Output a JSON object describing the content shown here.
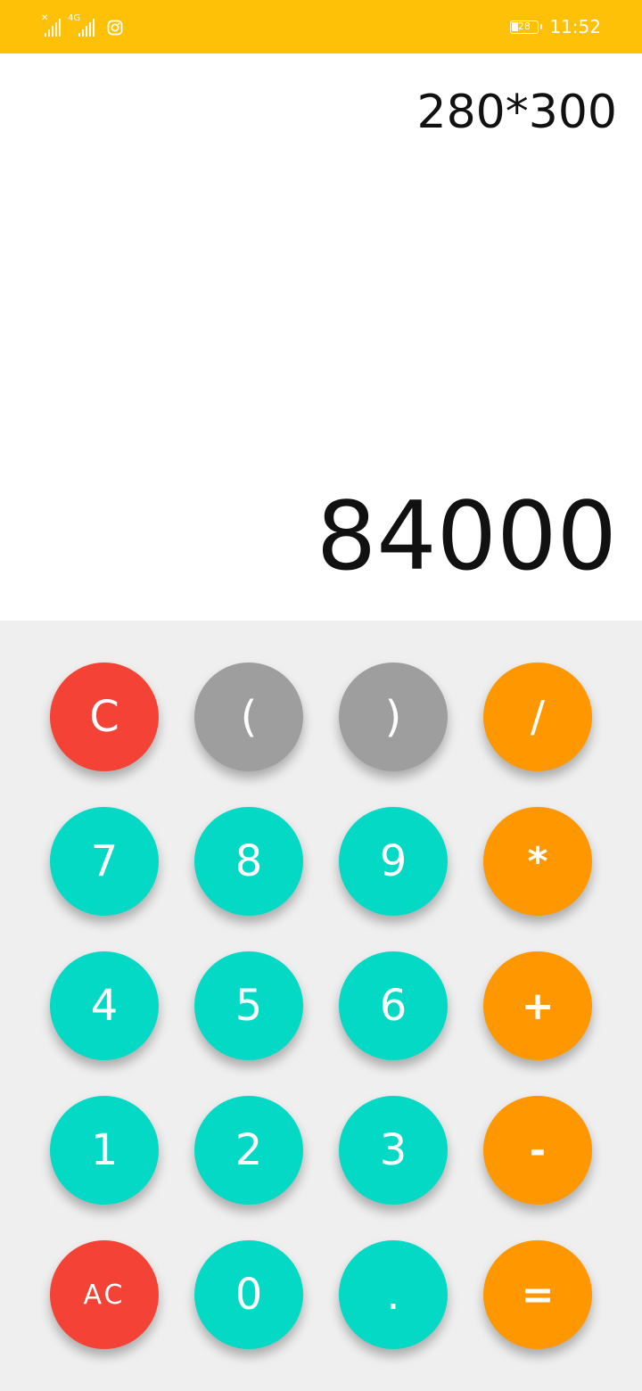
{
  "status_bar": {
    "background_color": "#ffc107",
    "sim1_signal": "no-service",
    "sim2_network": "4G",
    "notification_icon": "instagram-icon",
    "battery_level": "28",
    "time": "11:52"
  },
  "display": {
    "expression": "280*300",
    "result": "84000"
  },
  "keypad": {
    "rows": [
      [
        {
          "label": "C",
          "role": "clear",
          "color": "#f44336"
        },
        {
          "label": "(",
          "role": "paren",
          "color": "#9e9e9e"
        },
        {
          "label": ")",
          "role": "paren",
          "color": "#9e9e9e"
        },
        {
          "label": "/",
          "role": "operator",
          "color": "#ff9800"
        }
      ],
      [
        {
          "label": "7",
          "role": "digit",
          "color": "#03d9c5"
        },
        {
          "label": "8",
          "role": "digit",
          "color": "#03d9c5"
        },
        {
          "label": "9",
          "role": "digit",
          "color": "#03d9c5"
        },
        {
          "label": "*",
          "role": "operator",
          "color": "#ff9800"
        }
      ],
      [
        {
          "label": "4",
          "role": "digit",
          "color": "#03d9c5"
        },
        {
          "label": "5",
          "role": "digit",
          "color": "#03d9c5"
        },
        {
          "label": "6",
          "role": "digit",
          "color": "#03d9c5"
        },
        {
          "label": "+",
          "role": "operator",
          "color": "#ff9800"
        }
      ],
      [
        {
          "label": "1",
          "role": "digit",
          "color": "#03d9c5"
        },
        {
          "label": "2",
          "role": "digit",
          "color": "#03d9c5"
        },
        {
          "label": "3",
          "role": "digit",
          "color": "#03d9c5"
        },
        {
          "label": "-",
          "role": "operator",
          "color": "#ff9800"
        }
      ],
      [
        {
          "label": "AC",
          "role": "all-clear",
          "color": "#f44336"
        },
        {
          "label": "0",
          "role": "digit",
          "color": "#03d9c5"
        },
        {
          "label": ".",
          "role": "decimal",
          "color": "#03d9c5"
        },
        {
          "label": "=",
          "role": "equals",
          "color": "#ff9800"
        }
      ]
    ]
  }
}
